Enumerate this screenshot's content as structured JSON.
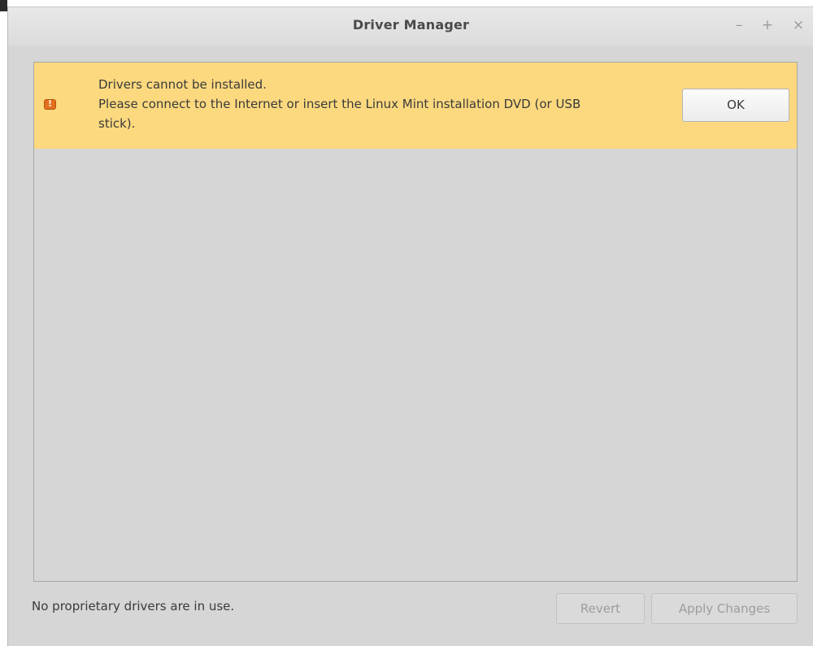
{
  "window": {
    "title": "Driver Manager",
    "controls": {
      "minimize": "–",
      "maximize": "+",
      "close": "×"
    }
  },
  "infobar": {
    "icon": "warning-icon",
    "line1": "Drivers cannot be installed.",
    "line2": "Please connect to the Internet or insert the Linux Mint installation DVD (or USB",
    "line3": "stick).",
    "ok_label": "OK",
    "color": "#fcd97f"
  },
  "footer": {
    "status": "No proprietary drivers are in use.",
    "revert_label": "Revert",
    "apply_label": "Apply Changes"
  },
  "colors": {
    "window_bg": "#d6d6d6",
    "infobar_bg": "#fcd97f",
    "warning_icon": "#e3701f"
  }
}
